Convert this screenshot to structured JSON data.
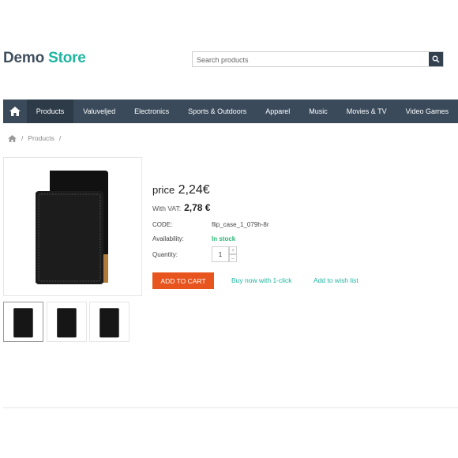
{
  "brand": {
    "part1": "Demo",
    "part2": "Store"
  },
  "search": {
    "placeholder": "Search products"
  },
  "nav": {
    "items": [
      {
        "label": "Products"
      },
      {
        "label": "Valuveljed"
      },
      {
        "label": "Electronics"
      },
      {
        "label": "Sports & Outdoors"
      },
      {
        "label": "Apparel"
      },
      {
        "label": "Music"
      },
      {
        "label": "Movies & TV"
      },
      {
        "label": "Video Games"
      }
    ]
  },
  "breadcrumb": {
    "sep": "/",
    "current": "Products"
  },
  "product": {
    "price_label": "price",
    "price": "2,24€",
    "vat_label": "With VAT:",
    "vat_price": "2,78 €",
    "code_label": "CODE:",
    "code": "flip_case_1_079h-8r",
    "availability_label": "Availability:",
    "availability": "In stock",
    "quantity_label": "Quantity:",
    "quantity": "1",
    "qty_up": "+",
    "qty_down": "–"
  },
  "actions": {
    "add_to_cart": "ADD TO CART",
    "buy_now": "Buy now with 1-click",
    "wishlist": "Add to wish list"
  },
  "colors": {
    "accent": "#1fb5a0",
    "nav_bg": "#3a4a5b",
    "cta": "#e8541e",
    "stock": "#2bb673"
  }
}
